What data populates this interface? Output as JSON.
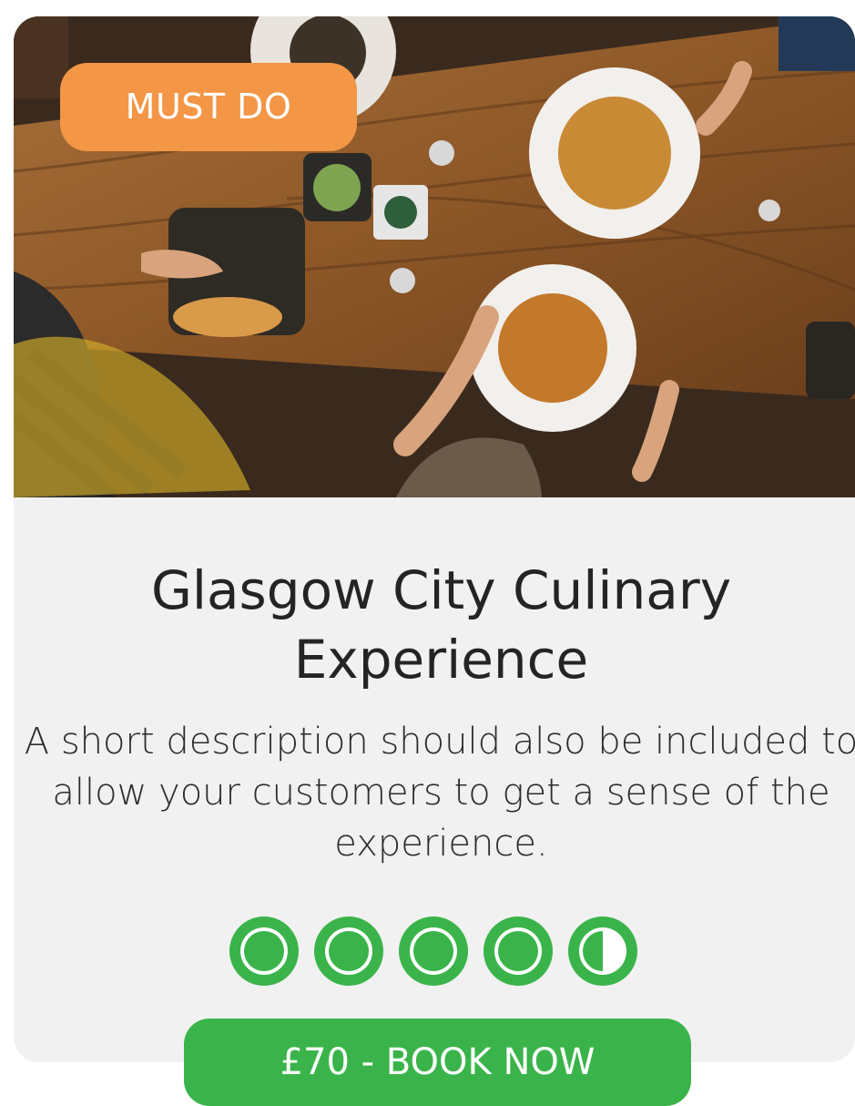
{
  "badge": {
    "label": "MUST DO"
  },
  "title": "Glasgow City Culinary Experience",
  "description": "A short description should also be included to allow your customers to get a sense of the experience.",
  "rating": {
    "value": 4.5,
    "max": 5,
    "color": "#3ab44a"
  },
  "book_button": {
    "label": "£70 - BOOK NOW",
    "color": "#3ab44a"
  },
  "colors": {
    "badge": "#f39646",
    "card_background": "#f1f1f1",
    "text": "#252325"
  },
  "hero_image": {
    "icon": "food-table-photo"
  }
}
